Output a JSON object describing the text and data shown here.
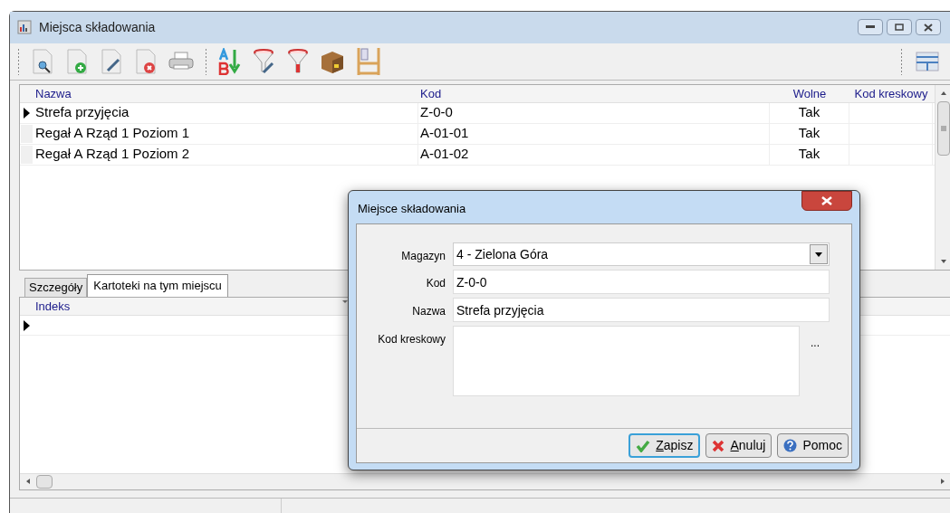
{
  "window": {
    "title": "Miejsca składowania"
  },
  "grid": {
    "columns": [
      "Nazwa",
      "Kod",
      "Wolne",
      "Kod kreskowy"
    ],
    "rows": [
      {
        "cells": [
          "Strefa przyjęcia",
          "Z-0-0",
          "Tak",
          null
        ],
        "selected": true
      },
      {
        "cells": [
          "Regał A Rząd 1 Poziom 1",
          "A-01-01",
          "Tak",
          null
        ],
        "selected": false
      },
      {
        "cells": [
          "Regał A Rząd 1 Poziom 2",
          "A-01-02",
          "Tak",
          null
        ],
        "selected": false
      }
    ]
  },
  "tabs": [
    {
      "label": "Szczegóły",
      "selected": false
    },
    {
      "label": "Kartoteki na tym miejscu",
      "selected": true
    }
  ],
  "lower_grid": {
    "columns": [
      "Indeks"
    ]
  },
  "dialog": {
    "title": "Miejsce składowania",
    "fields": [
      {
        "kind": "dropdown",
        "label": "Magazyn",
        "value": "4 - Zielona Góra"
      },
      {
        "kind": "text",
        "label": "Kod",
        "value": "Z-0-0"
      },
      {
        "kind": "text",
        "label": "Nazwa",
        "value": "Strefa przyjęcia"
      },
      {
        "kind": "memo",
        "label": "Kod kreskowy",
        "button": "..."
      }
    ],
    "buttons": [
      {
        "kind": "save",
        "label": "Zapisz",
        "default": true
      },
      {
        "kind": "cancel",
        "label": "Anuluj",
        "default": false
      },
      {
        "kind": "help",
        "label": "Pomoc",
        "default": false
      }
    ]
  }
}
